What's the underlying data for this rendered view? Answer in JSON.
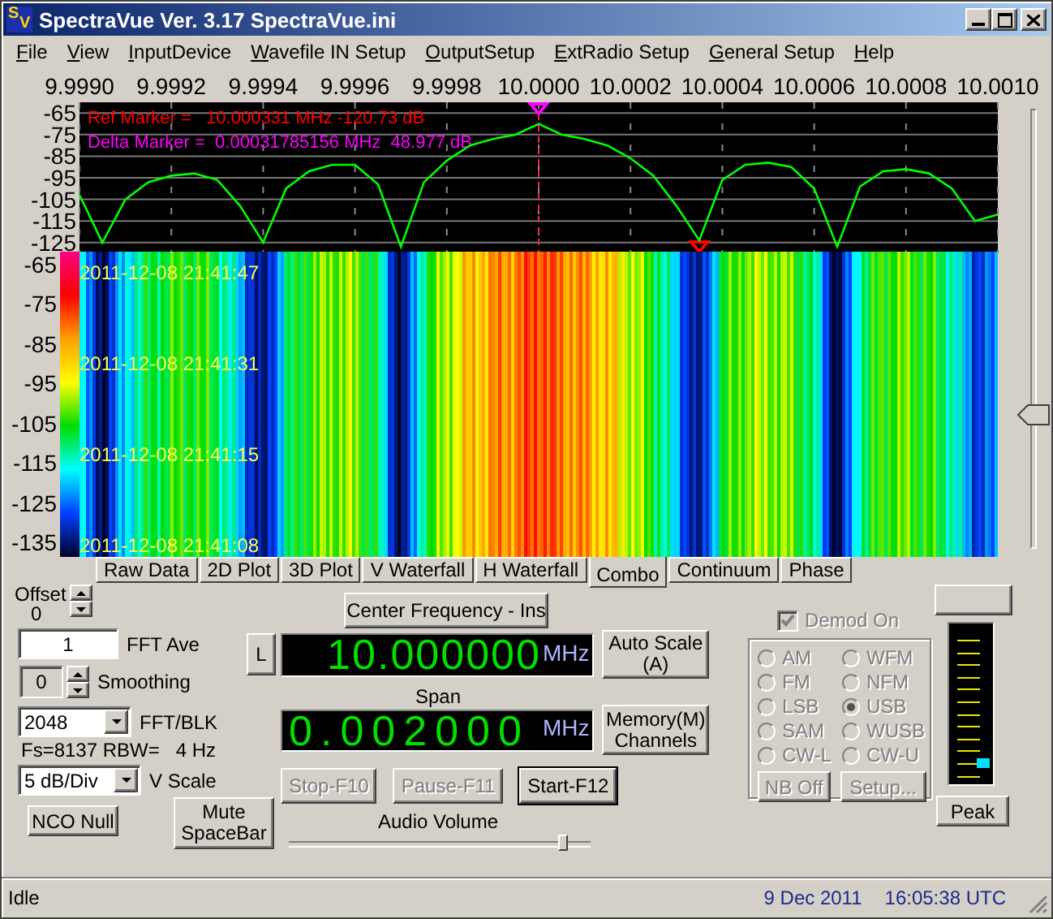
{
  "window": {
    "title": "SpectraVue Ver. 3.17 SpectraVue.ini",
    "logo": "SV"
  },
  "menu": [
    "File",
    "View",
    "InputDevice",
    "Wavefile IN Setup",
    "OutputSetup",
    "ExtRadio Setup",
    "General Setup",
    "Help"
  ],
  "spectrum": {
    "chart_data": {
      "type": "line",
      "x": [
        9.999,
        9.99905,
        9.9991,
        9.99915,
        9.9992,
        9.99925,
        9.9993,
        9.99935,
        9.9994,
        9.99945,
        9.9995,
        9.99955,
        9.9996,
        9.99965,
        9.9997,
        9.99975,
        9.9998,
        9.99985,
        9.9999,
        9.99995,
        10.0,
        10.00005,
        10.0001,
        10.00015,
        10.0002,
        10.00025,
        10.0003,
        10.00035,
        10.0004,
        10.00045,
        10.0005,
        10.00055,
        10.0006,
        10.00065,
        10.0007,
        10.00075,
        10.0008,
        10.00085,
        10.0009,
        10.00095,
        10.001
      ],
      "series": [
        {
          "color": "#00ff00",
          "values": [
            -103,
            -125,
            -105,
            -97,
            -94,
            -93,
            -96,
            -108,
            -125,
            -100,
            -92,
            -89,
            -89,
            -98,
            -127,
            -97,
            -87,
            -80,
            -77,
            -75,
            -70,
            -75,
            -77,
            -80,
            -86,
            -94,
            -108,
            -124,
            -96,
            -89,
            -88,
            -90,
            -100,
            -127,
            -99,
            -92,
            -91,
            -93,
            -100,
            -115,
            -112
          ]
        }
      ],
      "xlim": [
        9.999,
        10.001
      ],
      "ylim": [
        -130,
        -60
      ],
      "xticks": [
        {
          "value": 9.999,
          "label": "9.9990"
        },
        {
          "value": 9.9992,
          "label": "9.9992"
        },
        {
          "value": 9.9994,
          "label": "9.9994"
        },
        {
          "value": 9.9996,
          "label": "9.9996"
        },
        {
          "value": 9.9998,
          "label": "9.9998"
        },
        {
          "value": 10.0,
          "label": "10.0000"
        },
        {
          "value": 10.0002,
          "label": "10.0002"
        },
        {
          "value": 10.0004,
          "label": "10.0004"
        },
        {
          "value": 10.0006,
          "label": "10.0006"
        },
        {
          "value": 10.0008,
          "label": "10.0008"
        },
        {
          "value": 10.001,
          "label": "10.0010"
        }
      ],
      "yticks": [
        -65,
        -75,
        -85,
        -95,
        -105,
        -115,
        -125
      ],
      "grid": true,
      "ref_lines": [
        {
          "axis": "x",
          "value": 10.0
        }
      ],
      "annotations": [
        "Ref Marker =   10.000331 MHz -120.73 dB",
        "Delta Marker =  0.00031785156 MHz  48.977 dB"
      ]
    },
    "markers": [
      {
        "kind": "ref",
        "color": "#ff0000"
      },
      {
        "kind": "delta",
        "color": "#ff00ff"
      }
    ]
  },
  "waterfall": {
    "scale_labels": [
      "-65",
      "-75",
      "-85",
      "-95",
      "-105",
      "-115",
      "-125",
      "-135"
    ],
    "timestamps": [
      "2011-12-08 21:41:47",
      "2011-12-08 21:41:31",
      "2011-12-08 21:41:15",
      "2011-12-08 21:41:08"
    ]
  },
  "gain_slider": {
    "level": 0.31
  },
  "tabs": [
    {
      "label": "Raw Data",
      "selected": false
    },
    {
      "label": "2D Plot",
      "selected": false
    },
    {
      "label": "3D Plot",
      "selected": false
    },
    {
      "label": "V Waterfall",
      "selected": false
    },
    {
      "label": "H Waterfall",
      "selected": false
    },
    {
      "label": "Combo",
      "selected": true
    },
    {
      "label": "Continuum",
      "selected": false
    },
    {
      "label": "Phase",
      "selected": false
    }
  ],
  "offset": {
    "label": "Offset",
    "value": "0"
  },
  "fft_ave": {
    "value": "1",
    "label": "FFT Ave"
  },
  "smoothing": {
    "value": "0",
    "label": "Smoothing"
  },
  "fft_blk": {
    "value": "2048",
    "label": "FFT/BLK"
  },
  "fs_info": "Fs=8137 RBW=   4 Hz",
  "v_scale": {
    "value": "5 dB/Div",
    "label": "V Scale"
  },
  "nco_null_button": "NCO Null",
  "mute_button": [
    "Mute",
    "SpaceBar"
  ],
  "center_frequency_button": "Center Frequency - Ins",
  "lock_button": "L",
  "frequency": {
    "value": "10.000000",
    "unit": "MHz"
  },
  "auto_scale_button": [
    "Auto Scale",
    "(A)"
  ],
  "span": {
    "label": "Span",
    "value": "0.002000",
    "unit": "MHz"
  },
  "memory_button": [
    "Memory(M)",
    "Channels"
  ],
  "transport_buttons": [
    {
      "label": "Stop-F10",
      "disabled": true
    },
    {
      "label": "Pause-F11",
      "disabled": true
    },
    {
      "label": "Start-F12",
      "disabled": false
    }
  ],
  "audio_volume": {
    "label": "Audio Volume",
    "level": 0.93
  },
  "demod": {
    "label": "Demod On",
    "checked": true,
    "disabled": true,
    "modes": [
      {
        "label": "AM",
        "selected": false
      },
      {
        "label": "WFM",
        "selected": false
      },
      {
        "label": "FM",
        "selected": false
      },
      {
        "label": "NFM",
        "selected": false
      },
      {
        "label": "LSB",
        "selected": false
      },
      {
        "label": "USB",
        "selected": true
      },
      {
        "label": "SAM",
        "selected": false
      },
      {
        "label": "WUSB",
        "selected": false
      },
      {
        "label": "CW-L",
        "selected": false
      },
      {
        "label": "CW-U",
        "selected": false
      }
    ],
    "buttons": [
      "NB Off",
      "Setup..."
    ]
  },
  "meter": {
    "level": 0.1
  },
  "peak_button": "Peak",
  "status_bar": {
    "status": "Idle",
    "date": "9 Dec 2011",
    "time": "16:05:38 UTC"
  }
}
